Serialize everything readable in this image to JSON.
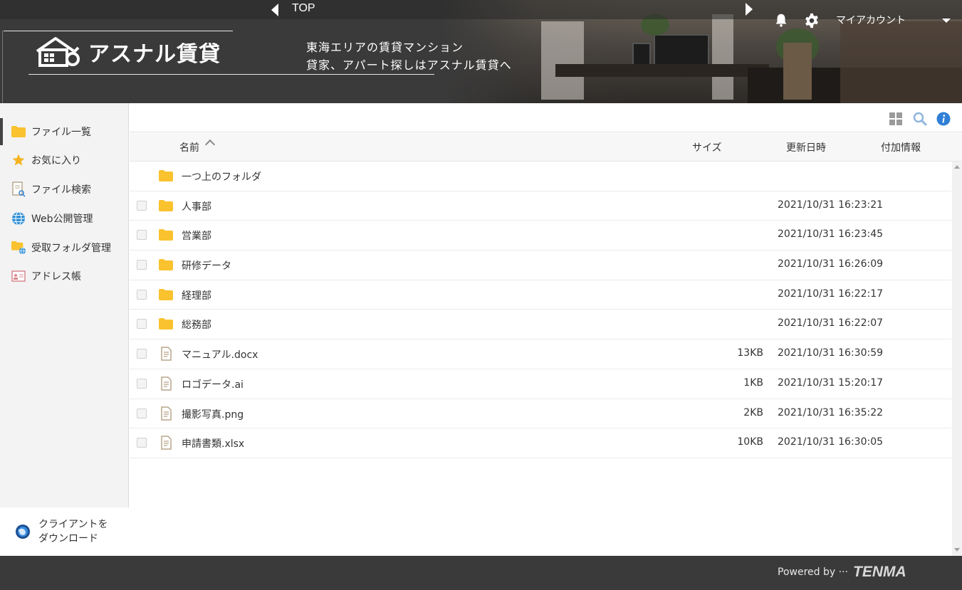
{
  "header": {
    "nav_label": "TOP",
    "logo_text": "アスナル賃貸",
    "tagline_line1": "東海エリアの賃貸マンション",
    "tagline_line2": "貸家、アパート探しはアスナル賃貸へ",
    "account_label": "マイアカウント"
  },
  "sidebar": {
    "items": [
      {
        "label": "ファイル一覧",
        "icon": "folder-icon"
      },
      {
        "label": "お気に入り",
        "icon": "star-icon"
      },
      {
        "label": "ファイル検索",
        "icon": "file-search-icon"
      },
      {
        "label": "Web公開管理",
        "icon": "globe-icon"
      },
      {
        "label": "受取フォルダ管理",
        "icon": "folder-globe-icon"
      },
      {
        "label": "アドレス帳",
        "icon": "address-card-icon"
      }
    ],
    "client_download_line1": "クライアントを",
    "client_download_line2": "ダウンロード"
  },
  "table": {
    "columns": {
      "name": "名前",
      "size": "サイズ",
      "updated": "更新日時",
      "info": "付加情報"
    },
    "parent_folder": "一つ上のフォルダ",
    "rows": [
      {
        "name": "人事部",
        "type": "folder",
        "size": "",
        "updated": "2021/10/31 16:23:21"
      },
      {
        "name": "営業部",
        "type": "folder",
        "size": "",
        "updated": "2021/10/31 16:23:45"
      },
      {
        "name": "研修データ",
        "type": "folder",
        "size": "",
        "updated": "2021/10/31 16:26:09"
      },
      {
        "name": "経理部",
        "type": "folder",
        "size": "",
        "updated": "2021/10/31 16:22:17"
      },
      {
        "name": "総務部",
        "type": "folder",
        "size": "",
        "updated": "2021/10/31 16:22:07"
      },
      {
        "name": "マニュアル.docx",
        "type": "file",
        "size": "13KB",
        "updated": "2021/10/31 16:30:59"
      },
      {
        "name": "ロゴデータ.ai",
        "type": "file",
        "size": "1KB",
        "updated": "2021/10/31 15:20:17"
      },
      {
        "name": "撮影写真.png",
        "type": "file",
        "size": "2KB",
        "updated": "2021/10/31 16:35:22"
      },
      {
        "name": "申請書類.xlsx",
        "type": "file",
        "size": "10KB",
        "updated": "2021/10/31 16:30:05"
      }
    ]
  },
  "footer": {
    "powered_by": "Powered by ···",
    "brand": "TENMA"
  },
  "colors": {
    "header_bg": "#3a3a3a",
    "folder": "#f9c22e",
    "accent_blue": "#2f7fd6"
  }
}
